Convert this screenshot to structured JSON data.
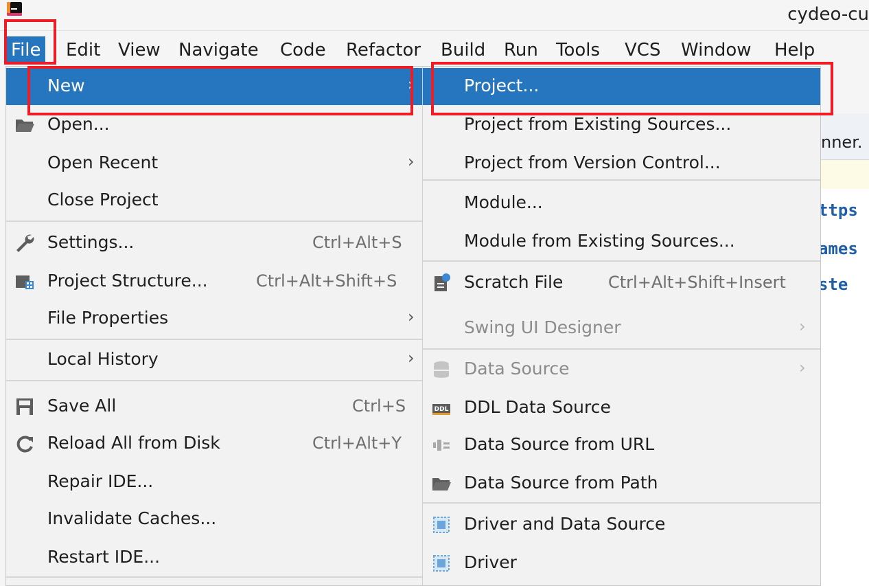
{
  "window": {
    "title": "cydeo-cu"
  },
  "menubar": {
    "items": [
      {
        "label": "File"
      },
      {
        "label": "Edit"
      },
      {
        "label": "View"
      },
      {
        "label": "Navigate"
      },
      {
        "label": "Code"
      },
      {
        "label": "Refactor"
      },
      {
        "label": "Build"
      },
      {
        "label": "Run"
      },
      {
        "label": "Tools"
      },
      {
        "label": "VCS"
      },
      {
        "label": "Window"
      },
      {
        "label": "Help"
      }
    ]
  },
  "file_menu": {
    "items": [
      {
        "label": "New",
        "icon": null,
        "submenu": true,
        "selected": true
      },
      {
        "label": "Open...",
        "icon": "folder-icon"
      },
      {
        "label": "Open Recent",
        "submenu": true
      },
      {
        "label": "Close Project"
      },
      {
        "label": "Settings...",
        "icon": "wrench-icon",
        "shortcut": "Ctrl+Alt+S"
      },
      {
        "label": "Project Structure...",
        "icon": "project-structure-icon",
        "shortcut": "Ctrl+Alt+Shift+S"
      },
      {
        "label": "File Properties",
        "submenu": true
      },
      {
        "label": "Local History",
        "submenu": true
      },
      {
        "label": "Save All",
        "icon": "save-icon",
        "shortcut": "Ctrl+S"
      },
      {
        "label": "Reload All from Disk",
        "icon": "reload-icon",
        "shortcut": "Ctrl+Alt+Y"
      },
      {
        "label": "Repair IDE..."
      },
      {
        "label": "Invalidate Caches..."
      },
      {
        "label": "Restart IDE..."
      }
    ]
  },
  "new_menu": {
    "items": [
      {
        "label": "Project...",
        "selected": true
      },
      {
        "label": "Project from Existing Sources..."
      },
      {
        "label": "Project from Version Control..."
      },
      {
        "label": "Module..."
      },
      {
        "label": "Module from Existing Sources..."
      },
      {
        "label": "Scratch File",
        "icon": "scratch-file-icon",
        "shortcut": "Ctrl+Alt+Shift+Insert"
      },
      {
        "label": "Swing UI Designer",
        "submenu": true,
        "disabled": true
      },
      {
        "label": "Data Source",
        "icon": "database-icon",
        "submenu": true,
        "disabled": true
      },
      {
        "label": "DDL Data Source",
        "icon": "ddl-icon"
      },
      {
        "label": "Data Source from URL",
        "icon": "url-datasource-icon"
      },
      {
        "label": "Data Source from Path",
        "icon": "folder-icon"
      },
      {
        "label": "Driver and Data Source",
        "icon": "driver-icon"
      },
      {
        "label": "Driver",
        "icon": "driver-icon"
      }
    ]
  },
  "editor": {
    "tab_label": "nner.",
    "code_lines": [
      "ttps",
      "ames",
      "ste"
    ]
  },
  "colors": {
    "selection": "#2675bf",
    "highlight_box": "#ee1c25",
    "menu_bg": "#f2f2f2"
  }
}
